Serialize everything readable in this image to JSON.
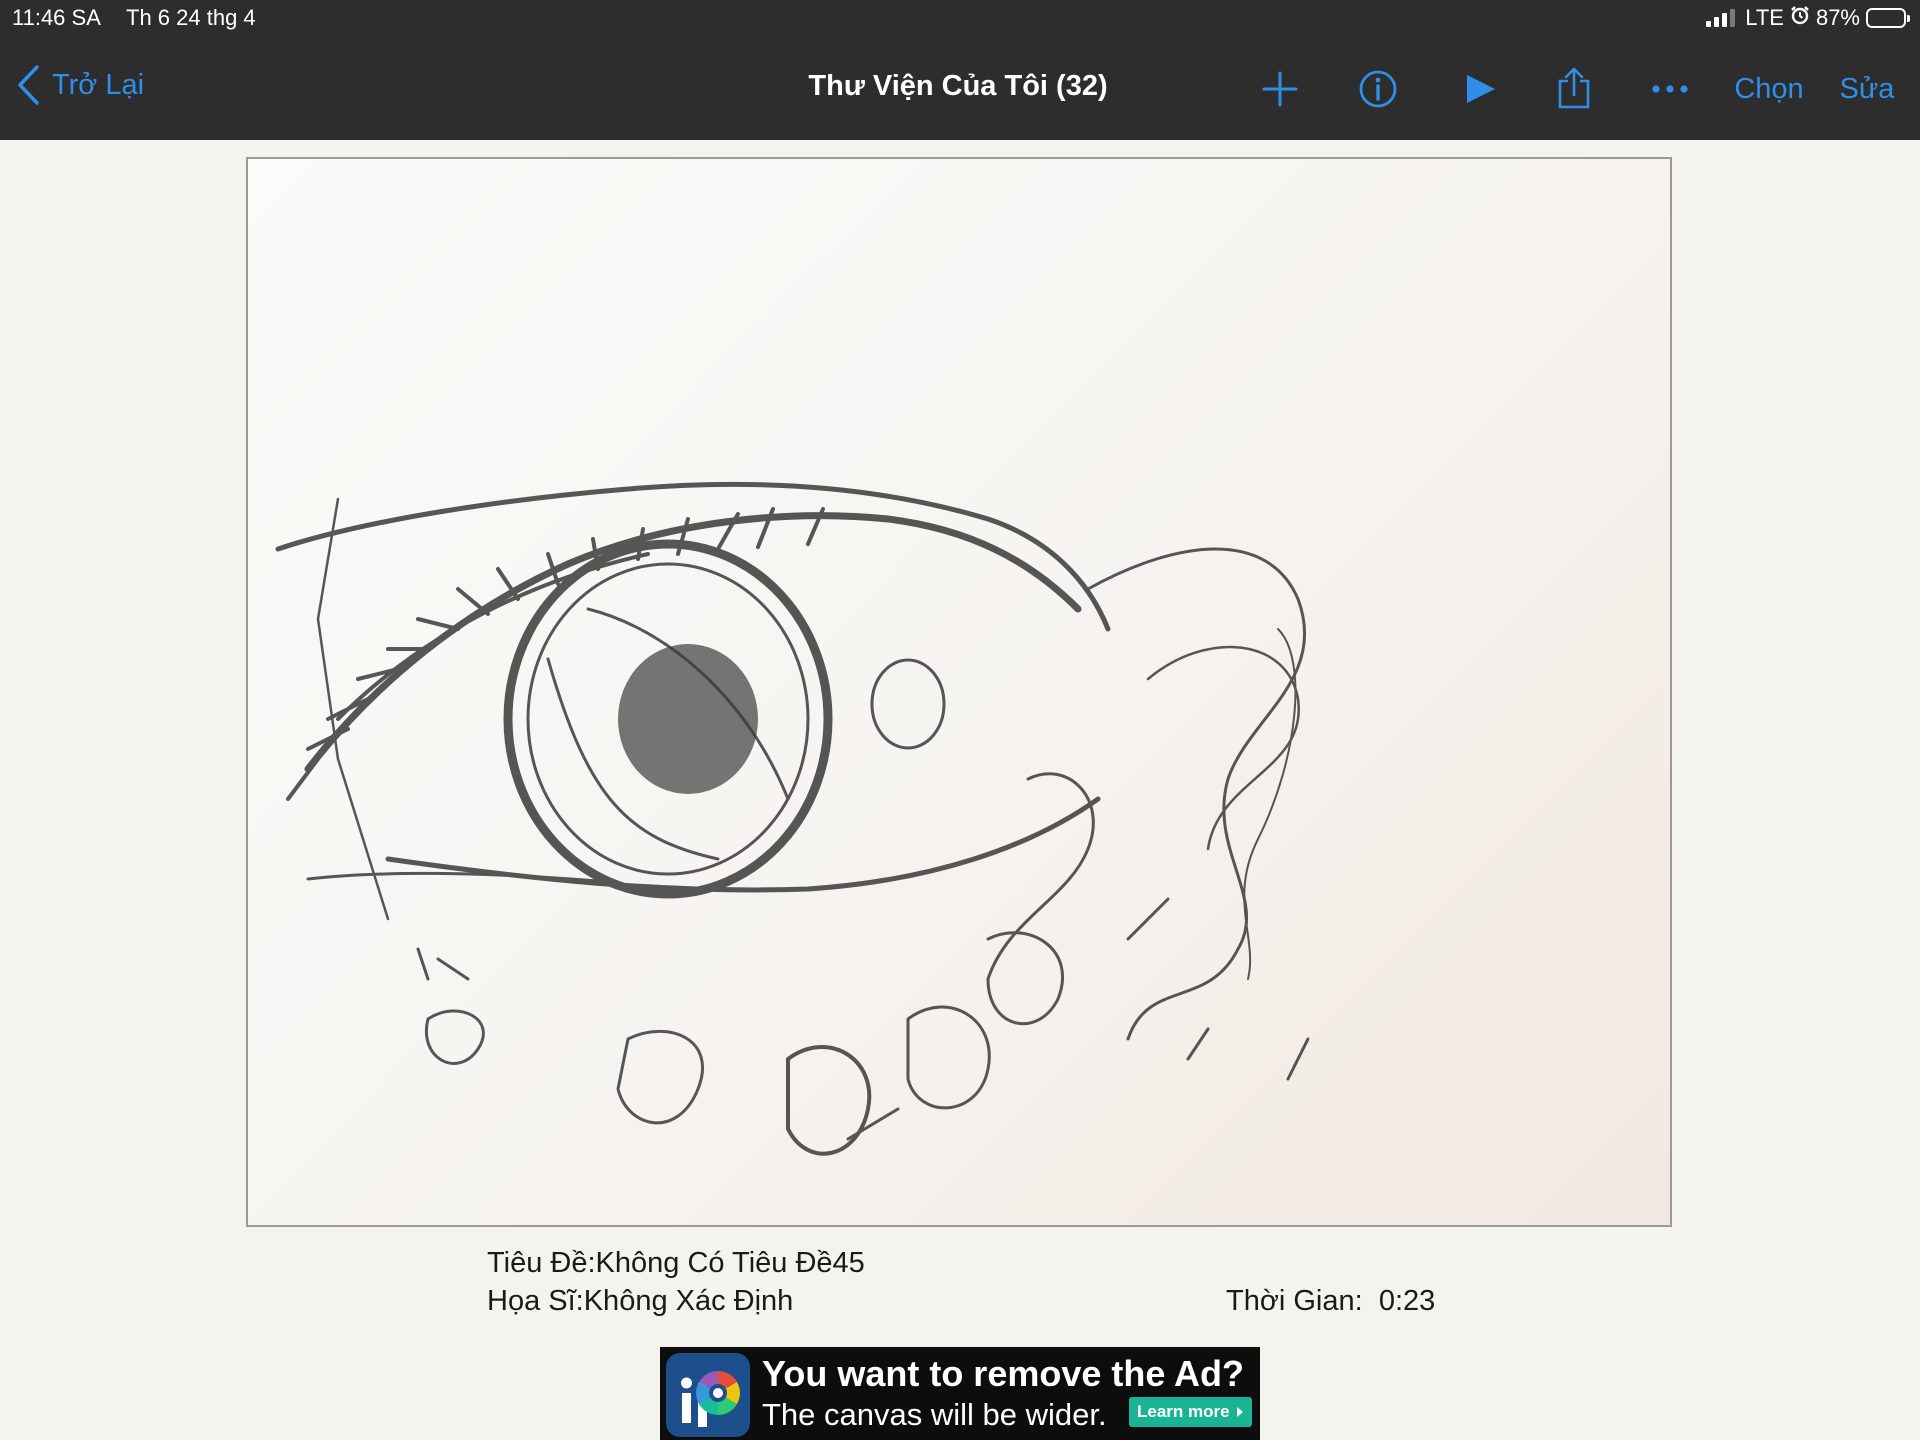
{
  "status_bar": {
    "time": "11:46 SA",
    "date": "Th 6 24 thg 4",
    "network": "LTE",
    "battery": "87%",
    "battery_level": 0.87,
    "icons": [
      "signal-icon",
      "alarm-icon",
      "battery-icon"
    ]
  },
  "nav": {
    "back_label": "Trở Lại",
    "title": "Thư Viện Của Tôi (32)",
    "select_label": "Chọn",
    "edit_label": "Sửa",
    "icons": [
      "chevron-left-icon",
      "plus-icon",
      "info-icon",
      "play-icon",
      "share-icon",
      "more-icon"
    ]
  },
  "artwork": {
    "title_label": "Tiêu Đề:",
    "title_value": "Không Có Tiêu Đề45",
    "artist_label": "Họa Sĩ:",
    "artist_value": "Không Xác Định",
    "time_label": "Thời Gian:",
    "time_value": "0:23"
  },
  "ad": {
    "headline": "You want to remove the Ad?",
    "subline": "The canvas will be wider.",
    "button": "Learn more"
  },
  "colors": {
    "nav_background": "#2d2d2d",
    "accent": "#2f8fe8",
    "page_background": "#f4f3ee",
    "ad_button": "#1ab394"
  }
}
